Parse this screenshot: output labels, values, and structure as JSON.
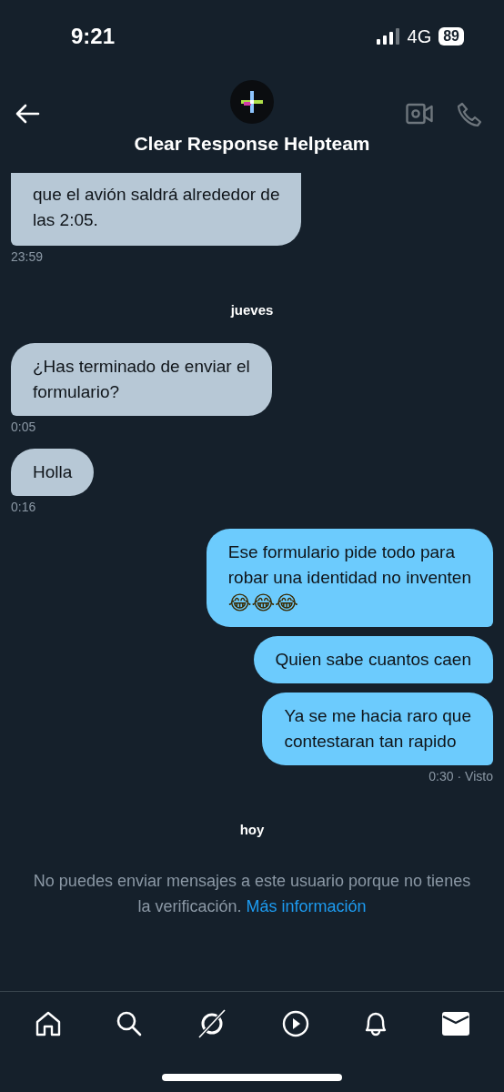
{
  "status_bar": {
    "time": "9:21",
    "network": "4G",
    "battery": "89"
  },
  "header": {
    "title": "Clear Response Helpteam"
  },
  "messages": [
    {
      "kind": "received",
      "text": "que el avión saldrá alrededor de\nlas 2:05.",
      "time": "23:59",
      "cut_top": true
    },
    {
      "kind": "day",
      "text": "jueves"
    },
    {
      "kind": "received",
      "text": "¿Has terminado de enviar el\nformulario?",
      "time": "0:05"
    },
    {
      "kind": "received",
      "text": "Holla",
      "time": "0:16"
    },
    {
      "kind": "sent",
      "text": "Ese formulario pide todo para\nrobar una identidad no inventen",
      "emojis": "😂😂😂"
    },
    {
      "kind": "sent",
      "text": "Quien sabe cuantos caen"
    },
    {
      "kind": "sent",
      "text": "Ya se me hacia raro que\ncontestaran tan rapido",
      "time": "0:30",
      "seen": "· Visto"
    },
    {
      "kind": "day",
      "text": "hoy"
    }
  ],
  "notice": {
    "text": "No puedes enviar mensajes a este usuario porque no tienes la verificación.",
    "link": "Más información"
  }
}
